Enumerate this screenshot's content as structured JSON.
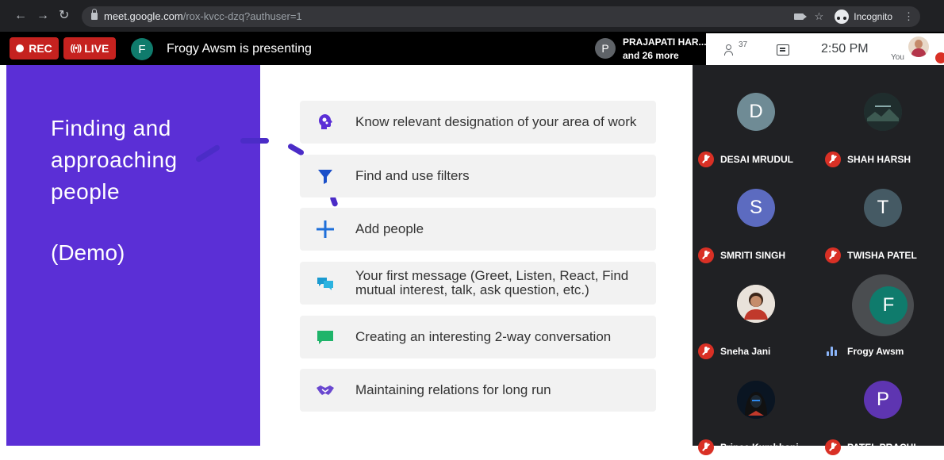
{
  "browser": {
    "url_host": "meet.google.com",
    "url_path": "/rox-kvcc-dzq?authuser=1",
    "incognito_label": "Incognito"
  },
  "meet": {
    "rec_label": "REC",
    "live_label": "LIVE",
    "presenter_initial": "F",
    "presenter_text": "Frogy Awsm is presenting",
    "participant_chip": {
      "initial": "P",
      "name": "PRAJAPATI HAR...",
      "more": "and 26 more"
    },
    "people_count": "37",
    "time": "2:50 PM",
    "you_label": "You"
  },
  "slide": {
    "title": "Finding and approaching people",
    "subtitle": "(Demo)",
    "items": [
      {
        "text": "Know relevant designation of your area of work",
        "icon": "head-gears-icon"
      },
      {
        "text": "Find and use filters",
        "icon": "filter-icon"
      },
      {
        "text": "Add people",
        "icon": "plus-icon"
      },
      {
        "text": "Your first message (Greet, Listen, React, Find mutual interest, talk, ask question, etc.)",
        "icon": "chat-bubbles-icon"
      },
      {
        "text": "Creating an interesting 2-way conversation",
        "icon": "message-icon"
      },
      {
        "text": "Maintaining relations for long run",
        "icon": "handshake-icon"
      }
    ]
  },
  "participants": [
    {
      "name": "DESAI MRUDUL",
      "initial": "D",
      "color": "#6f8b95",
      "muted": true
    },
    {
      "name": "SHAH HARSH",
      "initial": "",
      "color": "#2b3a3a",
      "muted": true
    },
    {
      "name": "SMRITI SINGH",
      "initial": "S",
      "color": "#5c6bc0",
      "muted": true
    },
    {
      "name": "TWISHA PATEL",
      "initial": "T",
      "color": "#455a64",
      "muted": true
    },
    {
      "name": "Sneha Jani",
      "initial": "",
      "color": "#d9c6b5",
      "muted": true
    },
    {
      "name": "Frogy Awsm",
      "initial": "F",
      "color": "#0f7b6c",
      "muted": false
    },
    {
      "name": "Prince Kumbhani",
      "initial": "",
      "color": "#0d1b2a",
      "muted": true
    },
    {
      "name": "PATEL PRACHI",
      "initial": "P",
      "color": "#5e35b1",
      "muted": true
    }
  ],
  "colors": {
    "slide_accent": "#5b2fd6",
    "rec_red": "#c5221f",
    "mute_red": "#d93025"
  }
}
